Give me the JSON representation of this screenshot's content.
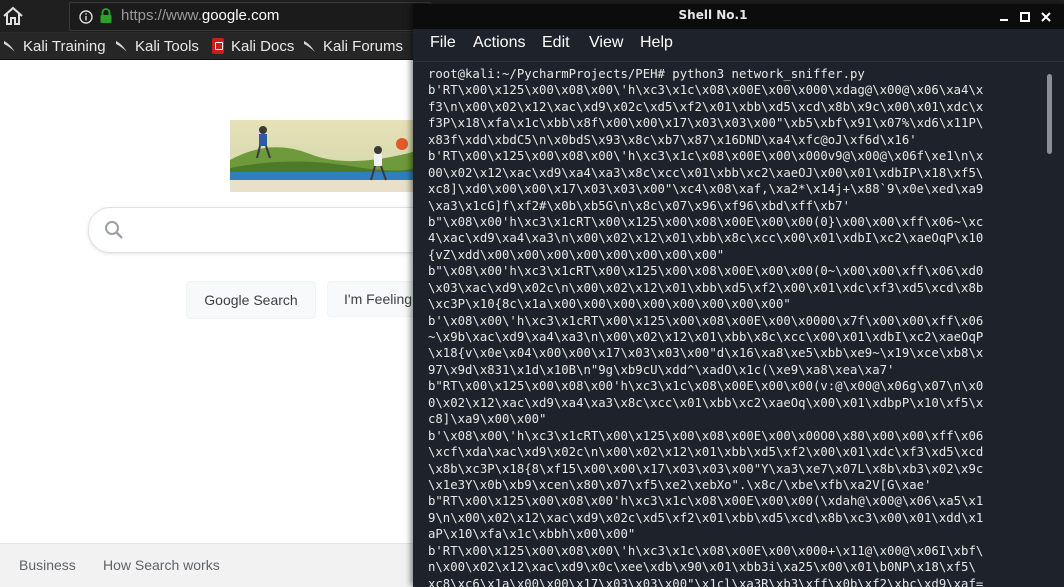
{
  "browser": {
    "url_scheme": "https://www.",
    "url_host": "google.com",
    "bookmarks": [
      {
        "label": "Kali Training",
        "icon": "kali-dragon-icon"
      },
      {
        "label": "Kali Tools",
        "icon": "kali-dragon-icon"
      },
      {
        "label": "Kali Docs",
        "icon": "kali-docs-icon"
      },
      {
        "label": "Kali Forums",
        "icon": "kali-dragon-icon"
      }
    ],
    "google": {
      "search_button": "Google Search",
      "lucky_button": "I'm Feeling",
      "footer_links": [
        "Business",
        "How Search works"
      ]
    }
  },
  "terminal": {
    "title": "Shell No.1",
    "menu": [
      "File",
      "Actions",
      "Edit",
      "View",
      "Help"
    ],
    "lines": [
      "root@kali:~/PycharmProjects/PEH# python3 network_sniffer.py",
      "b'RT\\x00\\x125\\x00\\x08\\x00\\'h\\xc3\\x1c\\x08\\x00E\\x00\\x000\\xdag@\\x00@\\x06\\xa4\\x",
      "f3\\n\\x00\\x02\\x12\\xac\\xd9\\x02c\\xd5\\xf2\\x01\\xbb\\xd5\\xcd\\x8b\\x9c\\x00\\x01\\xdc\\x",
      "f3P\\x18\\xfa\\x1c\\xbb\\x8f\\x00\\x00\\x17\\x03\\x03\\x00\"\\xb5\\xbf\\x91\\x07%\\xd6\\x11P\\",
      "x83f\\xdd\\xbdC5\\n\\x0bdS\\x93\\x8c\\xb7\\x87\\x16DND\\xa4\\xfc@oJ\\xf6d\\x16'",
      "b'RT\\x00\\x125\\x00\\x08\\x00\\'h\\xc3\\x1c\\x08\\x00E\\x00\\x000v9@\\x00@\\x06f\\xe1\\n\\x",
      "00\\x02\\x12\\xac\\xd9\\xa4\\xa3\\x8c\\xcc\\x01\\xbb\\xc2\\xaeOJ\\x00\\x01\\xdbIP\\x18\\xf5\\",
      "xc8]\\xd0\\x00\\x00\\x17\\x03\\x03\\x00\"\\xc4\\x08\\xaf,\\xa2*\\x14j+\\x88`9\\x0e\\xed\\xa9",
      "\\xa3\\x1cG]f\\xf2#\\x0b\\xb5G\\n\\x8c\\x07\\x96\\xf96\\xbd\\xff\\xb7'",
      "b\"\\x08\\x00'h\\xc3\\x1cRT\\x00\\x125\\x00\\x08\\x00E\\x00\\x00(0}\\x00\\x00\\xff\\x06~\\xc",
      "4\\xac\\xd9\\xa4\\xa3\\n\\x00\\x02\\x12\\x01\\xbb\\x8c\\xcc\\x00\\x01\\xdbI\\xc2\\xaeOqP\\x10",
      "{vZ\\xdd\\x00\\x00\\x00\\x00\\x00\\x00\\x00\\x00\"",
      "b\"\\x08\\x00'h\\xc3\\x1cRT\\x00\\x125\\x00\\x08\\x00E\\x00\\x00(0~\\x00\\x00\\xff\\x06\\xd0",
      "\\x03\\xac\\xd9\\x02c\\n\\x00\\x02\\x12\\x01\\xbb\\xd5\\xf2\\x00\\x01\\xdc\\xf3\\xd5\\xcd\\x8b",
      "\\xc3P\\x10{8c\\x1a\\x00\\x00\\x00\\x00\\x00\\x00\\x00\\x00\"",
      "b'\\x08\\x00\\'h\\xc3\\x1cRT\\x00\\x125\\x00\\x08\\x00E\\x00\\x0000\\x7f\\x00\\x00\\xff\\x06",
      "~\\x9b\\xac\\xd9\\xa4\\xa3\\n\\x00\\x02\\x12\\x01\\xbb\\x8c\\xcc\\x00\\x01\\xdbI\\xc2\\xaeOqP",
      "\\x18{v\\x0e\\x04\\x00\\x00\\x17\\x03\\x03\\x00\"d\\x16\\xa8\\xe5\\xbb\\xe9~\\x19\\xce\\xb8\\x",
      "97\\x9d\\x831\\x1d\\x10B\\n\"9g\\xb9cU\\xdd^\\xadO\\x1c(\\xe9\\xa8\\xea\\xa7'",
      "b\"RT\\x00\\x125\\x00\\x08\\x00'h\\xc3\\x1c\\x08\\x00E\\x00\\x00(v:@\\x00@\\x06g\\x07\\n\\x0",
      "0\\x02\\x12\\xac\\xd9\\xa4\\xa3\\x8c\\xcc\\x01\\xbb\\xc2\\xaeOq\\x00\\x01\\xdbpP\\x10\\xf5\\x",
      "c8]\\xa9\\x00\\x00\"",
      "b'\\x08\\x00\\'h\\xc3\\x1cRT\\x00\\x125\\x00\\x08\\x00E\\x00\\x00O0\\x80\\x00\\x00\\xff\\x06",
      "\\xcf\\xda\\xac\\xd9\\x02c\\n\\x00\\x02\\x12\\x01\\xbb\\xd5\\xf2\\x00\\x01\\xdc\\xf3\\xd5\\xcd",
      "\\x8b\\xc3P\\x18{8\\xf15\\x00\\x00\\x17\\x03\\x03\\x00\"Y\\xa3\\xe7\\x07L\\x8b\\xb3\\x02\\x9c",
      "\\x1e3Y\\x0b\\xb9\\xcen\\x80\\x07\\xf5\\xe2\\xebXo\".\\x8c/\\xbe\\xfb\\xa2V[G\\xae'",
      "b\"RT\\x00\\x125\\x00\\x08\\x00'h\\xc3\\x1c\\x08\\x00E\\x00\\x00(\\xdah@\\x00@\\x06\\xa5\\x1",
      "9\\n\\x00\\x02\\x12\\xac\\xd9\\x02c\\xd5\\xf2\\x01\\xbb\\xd5\\xcd\\x8b\\xc3\\x00\\x01\\xdd\\x1",
      "aP\\x10\\xfa\\x1c\\xbbh\\x00\\x00\"",
      "b'RT\\x00\\x125\\x00\\x08\\x00\\'h\\xc3\\x1c\\x08\\x00E\\x00\\x000+\\x11@\\x00@\\x06I\\xbf\\",
      "n\\x00\\x02\\x12\\xac\\xd9\\x0c\\xee\\xdb\\x90\\x01\\xbb3i\\xa25\\x00\\x01\\b0NP\\x18\\xf5\\",
      "xc8\\xc6\\x1a\\x00\\x00\\x17\\x03\\x03\\x00\"\\x1cl\\xa3R\\xb3\\xff\\x0b\\xf2\\xbc\\xd9\\xaf="
    ]
  },
  "colors": {
    "terminal_bg": "#1d222b",
    "terminal_titlebar": "#0c0c0c",
    "browser_chrome": "#1f1f1f",
    "lock_green": "#29a329"
  }
}
